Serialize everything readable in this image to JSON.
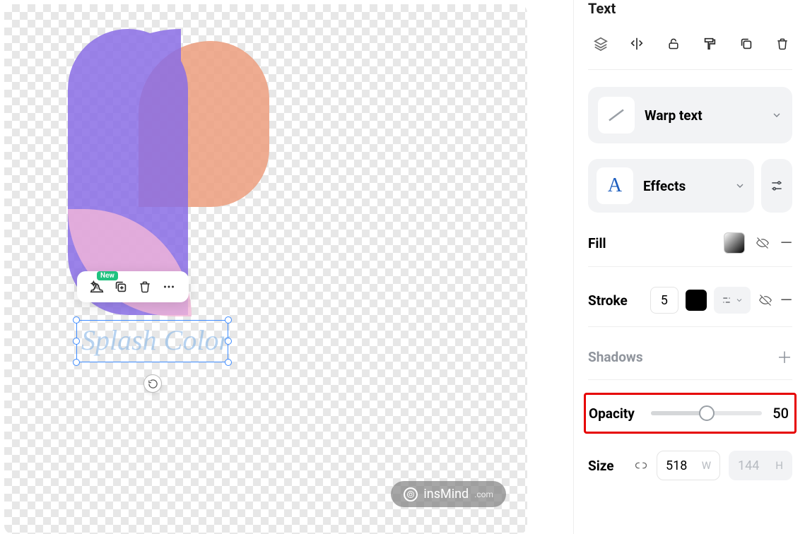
{
  "panel": {
    "title": "Text",
    "warp": {
      "label": "Warp text"
    },
    "effects": {
      "label": "Effects",
      "letter": "A"
    },
    "fill": {
      "label": "Fill"
    },
    "stroke": {
      "label": "Stroke",
      "width": "5"
    },
    "shadows": {
      "label": "Shadows"
    },
    "opacity": {
      "label": "Opacity",
      "value": "50"
    },
    "size": {
      "label": "Size",
      "w": "518",
      "wUnit": "W",
      "h": "144",
      "hUnit": "H"
    }
  },
  "canvas": {
    "text": "Splash Color",
    "toolbar_badge": "New"
  },
  "watermark": {
    "brand": "insMind",
    "domain": ".com"
  }
}
